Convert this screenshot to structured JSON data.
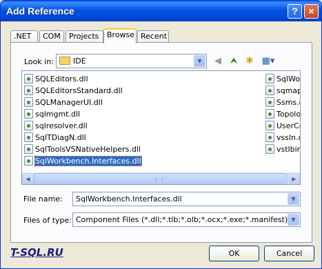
{
  "window": {
    "title": "Add Reference",
    "help_label": "?",
    "close_label": "×"
  },
  "tabs": [
    {
      "label": ".NET"
    },
    {
      "label": "COM"
    },
    {
      "label": "Projects"
    },
    {
      "label": "Browse",
      "active": true
    },
    {
      "label": "Recent"
    }
  ],
  "look_in": {
    "label": "Look in:",
    "value": "IDE"
  },
  "files": {
    "column1": [
      "SQLEditors.dll",
      "SQLEditorsStandard.dll",
      "SQLManagerUI.dll",
      "sqlmgmt.dll",
      "sqlresolver.dll",
      "SqlTDiagN.dll",
      "SqlToolsVSNativeHelpers.dll",
      "SqlWorkbench.Interfaces.dll"
    ],
    "column2": [
      "SqlWork",
      "sqmapi.",
      "Ssms.ex",
      "Topolog",
      "UserCor",
      "vssln.dl",
      "vstlbinf"
    ],
    "selected": "SqlWorkbench.Interfaces.dll"
  },
  "file_name": {
    "label": "File name:",
    "value": "SqlWorkbench.Interfaces.dll"
  },
  "files_of_type": {
    "label": "Files of type:",
    "value": "Component Files (*.dll;*.tlb;*.olb;*.ocx;*.exe;*.manifest)"
  },
  "buttons": {
    "ok": "OK",
    "cancel": "Cancel"
  },
  "brand": "T-SQL.RU"
}
